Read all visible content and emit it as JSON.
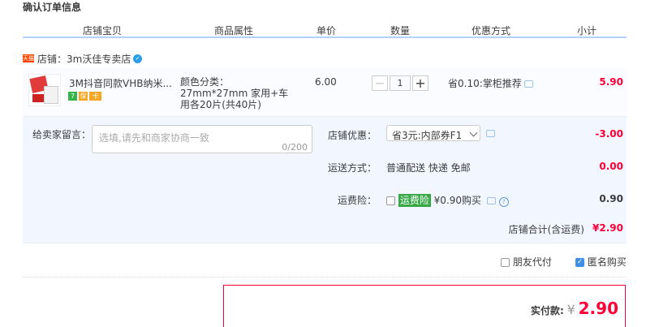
{
  "page": {
    "title": "确认订单信息"
  },
  "header": {
    "columns": [
      "店铺宝贝",
      "商品属性",
      "单价",
      "数量",
      "优惠方式",
      "小计"
    ]
  },
  "shop": {
    "tag": "天猫",
    "label": "店铺：",
    "name": "3m沃佳专卖店"
  },
  "item": {
    "name": "3M抖音同款VHB纳米...",
    "badges": [
      "7",
      "保",
      "卡"
    ],
    "props": "颜色分类：27mm*27mm 家用+车用各20片(共40片)",
    "price": "6.00",
    "quantity": "1",
    "promo": "省0.10:掌柜推荐",
    "subtotal": "5.90"
  },
  "message": {
    "label": "给卖家留言：",
    "placeholder": "选填,请先和商家协商一致",
    "count": "0/200"
  },
  "options": {
    "coupon_label": "店铺优惠：",
    "coupon_value": "省3元:内部券F1",
    "coupon_amount": "-3.00",
    "shipping_label": "运送方式：",
    "shipping_value": "普通配送 快递 免邮",
    "shipping_amount": "0.00",
    "insurance_label": "运费险：",
    "insurance_badge": "运费险",
    "insurance_text": "¥0.90购买",
    "insurance_amount": "0.90",
    "shop_total_label": "店铺合计(含运费)",
    "shop_total_amount": "¥2.90"
  },
  "extras": {
    "friend_pay": "朋友代付",
    "anonymous": "匿名购买",
    "anonymous_checked": true,
    "friend_checked": false
  },
  "payment": {
    "label": "实付款:",
    "currency": "¥",
    "amount": "2.90"
  }
}
